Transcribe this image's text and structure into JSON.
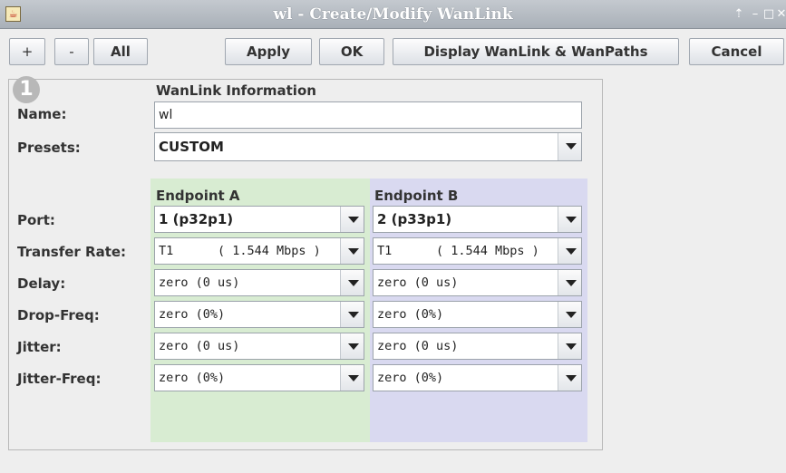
{
  "window": {
    "title": "wl - Create/Modify WanLink"
  },
  "toolbar": {
    "plus": "+",
    "minus": "-",
    "all": "All",
    "apply": "Apply",
    "ok": "OK",
    "display": "Display WanLink & WanPaths",
    "cancel": "Cancel"
  },
  "section": {
    "title": "WanLink Information",
    "badge": "1"
  },
  "form": {
    "name_label": "Name:",
    "name_value": "wl",
    "presets_label": "Presets:",
    "presets_value": "CUSTOM"
  },
  "endpoints": {
    "a_header": "Endpoint A",
    "b_header": "Endpoint B",
    "rows": [
      {
        "label": "Port:",
        "a": "1 (p32p1)",
        "b": "2 (p33p1)"
      },
      {
        "label": "Transfer Rate:",
        "a": "T1      ( 1.544 Mbps )",
        "b": "T1      ( 1.544 Mbps )"
      },
      {
        "label": "Delay:",
        "a": "zero (0 us)",
        "b": "zero (0 us)"
      },
      {
        "label": "Drop-Freq:",
        "a": "zero (0%)",
        "b": "zero (0%)"
      },
      {
        "label": "Jitter:",
        "a": "zero (0 us)",
        "b": "zero (0 us)"
      },
      {
        "label": "Jitter-Freq:",
        "a": "zero (0%)",
        "b": "zero (0%)"
      }
    ]
  },
  "colors": {
    "endpoint_a_bg": "#d8ecd2",
    "endpoint_b_bg": "#d9d9f0",
    "titlebar": "#b3b9c0"
  }
}
